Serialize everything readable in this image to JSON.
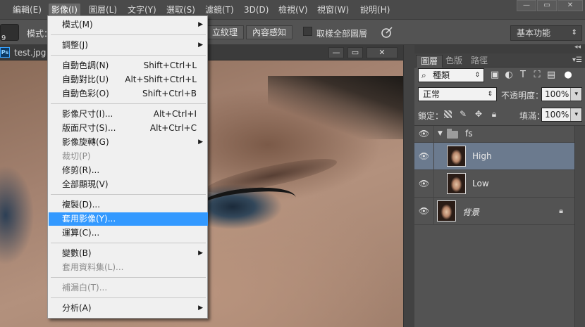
{
  "menubar": {
    "items": [
      "編輯(E)",
      "影像(I)",
      "圖層(L)",
      "文字(Y)",
      "選取(S)",
      "濾鏡(T)",
      "3D(D)",
      "檢視(V)",
      "視窗(W)",
      "說明(H)"
    ],
    "active_index": 1,
    "window_controls": [
      "—",
      "▭",
      "✕"
    ]
  },
  "options": {
    "preset_value": "9",
    "mode_label": "模式：",
    "btn_texture": "立紋理",
    "btn_content_aware": "內容感知",
    "sample_all_label": "取樣全部圖層",
    "workspace": "基本功能"
  },
  "document": {
    "ps_icon": "Ps",
    "tab_title": "test.jpg @",
    "controls": [
      "—",
      "▭",
      "✕"
    ]
  },
  "image_menu": {
    "items": [
      {
        "label": "模式(M)",
        "shortcut": "",
        "submenu": true,
        "disabled": false
      },
      {
        "label": "調整(J)",
        "shortcut": "",
        "submenu": true,
        "disabled": false
      },
      {
        "label": "自動色調(N)",
        "shortcut": "Shift+Ctrl+L",
        "submenu": false,
        "disabled": false
      },
      {
        "label": "自動對比(U)",
        "shortcut": "Alt+Shift+Ctrl+L",
        "submenu": false,
        "disabled": false
      },
      {
        "label": "自動色彩(O)",
        "shortcut": "Shift+Ctrl+B",
        "submenu": false,
        "disabled": false
      },
      {
        "label": "影像尺寸(I)...",
        "shortcut": "Alt+Ctrl+I",
        "submenu": false,
        "disabled": false
      },
      {
        "label": "版面尺寸(S)...",
        "shortcut": "Alt+Ctrl+C",
        "submenu": false,
        "disabled": false
      },
      {
        "label": "影像旋轉(G)",
        "shortcut": "",
        "submenu": true,
        "disabled": false
      },
      {
        "label": "裁切(P)",
        "shortcut": "",
        "submenu": false,
        "disabled": true
      },
      {
        "label": "修剪(R)...",
        "shortcut": "",
        "submenu": false,
        "disabled": false
      },
      {
        "label": "全部顯現(V)",
        "shortcut": "",
        "submenu": false,
        "disabled": false
      },
      {
        "label": "複製(D)...",
        "shortcut": "",
        "submenu": false,
        "disabled": false
      },
      {
        "label": "套用影像(Y)...",
        "shortcut": "",
        "submenu": false,
        "disabled": false,
        "highlighted": true
      },
      {
        "label": "運算(C)...",
        "shortcut": "",
        "submenu": false,
        "disabled": false
      },
      {
        "label": "變數(B)",
        "shortcut": "",
        "submenu": true,
        "disabled": false
      },
      {
        "label": "套用資料集(L)...",
        "shortcut": "",
        "submenu": false,
        "disabled": true
      },
      {
        "label": "補漏白(T)...",
        "shortcut": "",
        "submenu": false,
        "disabled": true
      },
      {
        "label": "分析(A)",
        "shortcut": "",
        "submenu": true,
        "disabled": false
      }
    ]
  },
  "layers_panel": {
    "tabs": [
      "圖層",
      "色版",
      "路徑"
    ],
    "active_tab": 0,
    "filter_kind": "種類",
    "blend_mode": "正常",
    "opacity_label": "不透明度：",
    "opacity_value": "100%",
    "lock_label": "鎖定：",
    "fill_label": "填滿：",
    "fill_value": "100%",
    "group_name": "fs",
    "layers": [
      {
        "name": "High",
        "selected": true
      },
      {
        "name": "Low",
        "selected": false
      },
      {
        "name": "背景",
        "selected": false,
        "locked": true
      }
    ]
  }
}
